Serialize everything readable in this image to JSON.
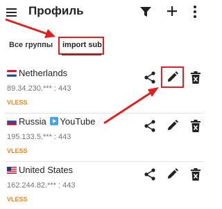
{
  "appbar": {
    "title": "Профиль",
    "icons": [
      "menu-icon",
      "filter-icon",
      "add-icon",
      "more-icon"
    ]
  },
  "tabs": [
    {
      "label": "Все группы",
      "selected": false
    },
    {
      "label": "import sub",
      "selected": true
    }
  ],
  "servers": [
    {
      "name": "Netherlands",
      "flag": "netherlands-flag",
      "address": "89.34.230.*** : 443",
      "protocol": "VLESS"
    },
    {
      "name_part1": "Russia",
      "name_part2": "YouTube",
      "flag": "russia-flag",
      "address": "195.133.5.*** : 443",
      "protocol": "VLESS"
    },
    {
      "name": "United States",
      "flag": "usa-flag",
      "address": "162.244.82.*** : 443",
      "protocol": "VLESS"
    }
  ],
  "colors": {
    "annotation": "#e02020",
    "protocol": "#e8871e",
    "text": "#222222",
    "address": "#777777"
  }
}
